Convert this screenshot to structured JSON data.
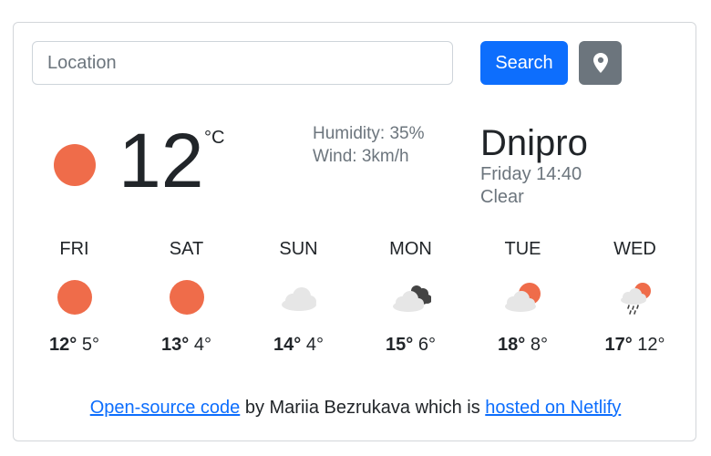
{
  "search": {
    "placeholder": "Location",
    "button_label": "Search"
  },
  "current": {
    "temperature": "12",
    "unit": "°C",
    "humidity": "Humidity: 35%",
    "wind": "Wind: 3km/h",
    "city": "Dnipro",
    "datetime": "Friday 14:40",
    "condition": "Clear",
    "icon": "sun-icon"
  },
  "forecast": [
    {
      "day": "FRI",
      "max": "12°",
      "min": "5°",
      "icon": "sun-icon"
    },
    {
      "day": "SAT",
      "max": "13°",
      "min": "4°",
      "icon": "sun-icon"
    },
    {
      "day": "SUN",
      "max": "14°",
      "min": "4°",
      "icon": "cloud-icon"
    },
    {
      "day": "MON",
      "max": "15°",
      "min": "6°",
      "icon": "dark-clouds-icon"
    },
    {
      "day": "TUE",
      "max": "18°",
      "min": "8°",
      "icon": "partly-cloudy-icon"
    },
    {
      "day": "WED",
      "max": "17°",
      "min": "12°",
      "icon": "rain-icon"
    }
  ],
  "footer": {
    "code_link": "Open-source code",
    "by_text": " by Mariia Bezrukava which is ",
    "hosted_link": "hosted on Netlify"
  },
  "colors": {
    "accent": "#0d6efd",
    "secondary": "#6c757d",
    "sun": "#ef6c4a",
    "cloud": "#e6e6e6",
    "dark_cloud": "#444444"
  }
}
